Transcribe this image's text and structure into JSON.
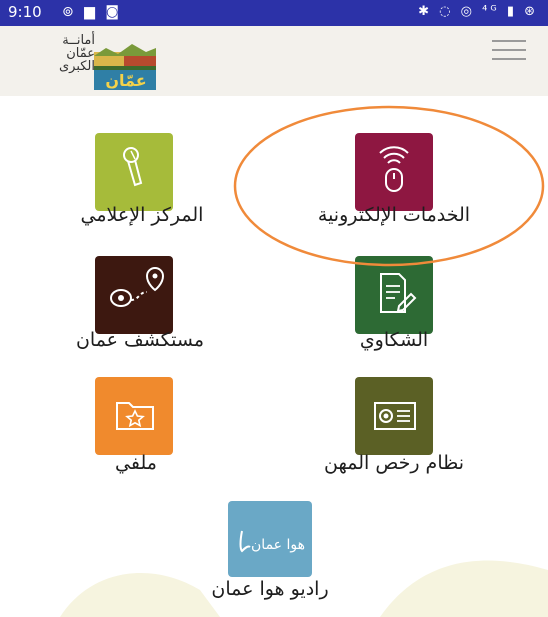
{
  "status_bar": {
    "time": "9:10",
    "left_icons": "⊚ ▆ ◙",
    "right_icons": "✱ ◌ ◎ ⁴ᴳ ▮ ⊛"
  },
  "header": {
    "logo_lines": [
      "أمانــة",
      "عمّان",
      "الكبرى"
    ],
    "emblem_text": "عمّان",
    "menu_icon": "hamburger-menu-icon"
  },
  "services": [
    {
      "id": "eservices",
      "label": "الخدمات الإلكترونية",
      "color": "#8e1741",
      "icon": "touch-mouse-icon"
    },
    {
      "id": "media",
      "label": "المركز الإعلامي",
      "color": "#a6bb3a",
      "icon": "microphone-icon"
    },
    {
      "id": "complaints",
      "label": "الشكاوي",
      "color": "#2d6a34",
      "icon": "document-edit-icon"
    },
    {
      "id": "explorer",
      "label": "مستكشف عمان",
      "color": "#3d1810",
      "icon": "map-pin-route-icon"
    },
    {
      "id": "licenses",
      "label": "نظام رخص المهن",
      "color": "#5b6025",
      "icon": "certificate-icon"
    },
    {
      "id": "malfi",
      "label": "ملفي",
      "color": "#f08a2d",
      "icon": "star-folder-icon"
    },
    {
      "id": "radio",
      "label": "راديو هوا عمان",
      "color": "#6aa8c6",
      "icon": "hawa-amman-logo",
      "logo_text": "هوا عمان"
    }
  ],
  "colors": {
    "status_bar": "#2c32a8",
    "header_bg": "#f3f1ec",
    "highlight": "#f08a3a"
  }
}
